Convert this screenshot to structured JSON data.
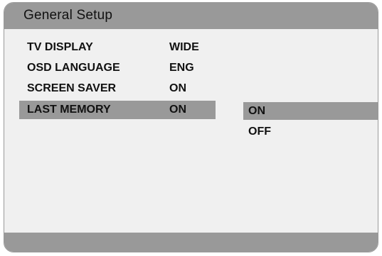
{
  "window": {
    "title": "General Setup"
  },
  "settings": [
    {
      "label": "TV DISPLAY",
      "value": "WIDE"
    },
    {
      "label": "OSD LANGUAGE",
      "value": "ENG"
    },
    {
      "label": "SCREEN SAVER",
      "value": "ON"
    },
    {
      "label": "LAST MEMORY",
      "value": "ON"
    }
  ],
  "options": [
    {
      "label": "ON"
    },
    {
      "label": "OFF"
    }
  ],
  "colors": {
    "panel_background": "#f0f0f0",
    "highlight": "#999999",
    "text": "#111111"
  }
}
